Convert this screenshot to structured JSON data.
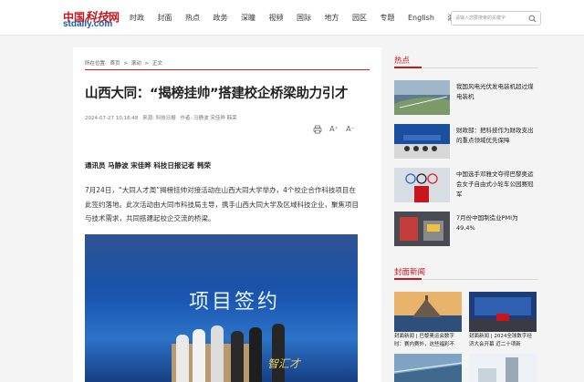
{
  "logo": {
    "cn_prefix": "中国",
    "cn_bold": "科技",
    "cn_suffix": "网",
    "en": "stdaily.com"
  },
  "nav": [
    "时政",
    "封面",
    "热点",
    "政务",
    "深瞳",
    "视频",
    "国际",
    "地方",
    "园区",
    "专题",
    "English",
    "滚动"
  ],
  "search": {
    "placeholder": "请输入您要搜索的关键字",
    "icon": "search-icon"
  },
  "breadcrumb": {
    "label": "所在位置:",
    "items": [
      "首页",
      ">",
      "滚动",
      ">",
      "正文"
    ]
  },
  "article": {
    "title": "山西大同：“揭榜挂帅”搭建校企桥梁助力引才",
    "meta": {
      "datetime": "2024-07-27 10:16:48",
      "source": "来源: 科技日报",
      "author": "作者: 马静波 宋佳晔 韩荣"
    },
    "tools": {
      "print": "print-icon",
      "font_larger": "A⁺",
      "font_smaller": "A⁻"
    },
    "byline": "通讯员 马静波 宋佳晔 科技日报记者 韩荣",
    "paragraph": "7月24日，“大同人才周”揭榜挂帅对接活动在山西大同大学举办，4个校企合作科技项目在此签约落地。此次活动由大同市科技局主导，携手山西大同大学及区域科技企业，聚焦项目与技术需求，共同搭建起校企交流的桥梁。",
    "photo": {
      "banner_text": "项目签约",
      "banner_sub": "智汇才"
    }
  },
  "sidebar": {
    "hot": {
      "heading": "热点",
      "items": [
        {
          "text": "我国风电光伏发电装机超过煤电装机"
        },
        {
          "text": "财政部：把科技作为财政支出的重点领域优先保障"
        },
        {
          "text": "中国选手邓雅文夺得巴黎奥运会女子自由式小轮车公园赛冠军"
        },
        {
          "text": "7月份中国制造业PMI为49.4%"
        }
      ]
    },
    "cover": {
      "heading": "封面新闻",
      "items": [
        {
          "text": "封面新闻 | 巴黎奥运会数字时：赛内赛外，这些福彩不"
        },
        {
          "text": "封面新闻 | 2024全球数字经济大会开幕 近二十项新"
        }
      ]
    }
  },
  "colors": {
    "brand_red": "#c8161d",
    "brand_blue": "#1f5aa6"
  }
}
